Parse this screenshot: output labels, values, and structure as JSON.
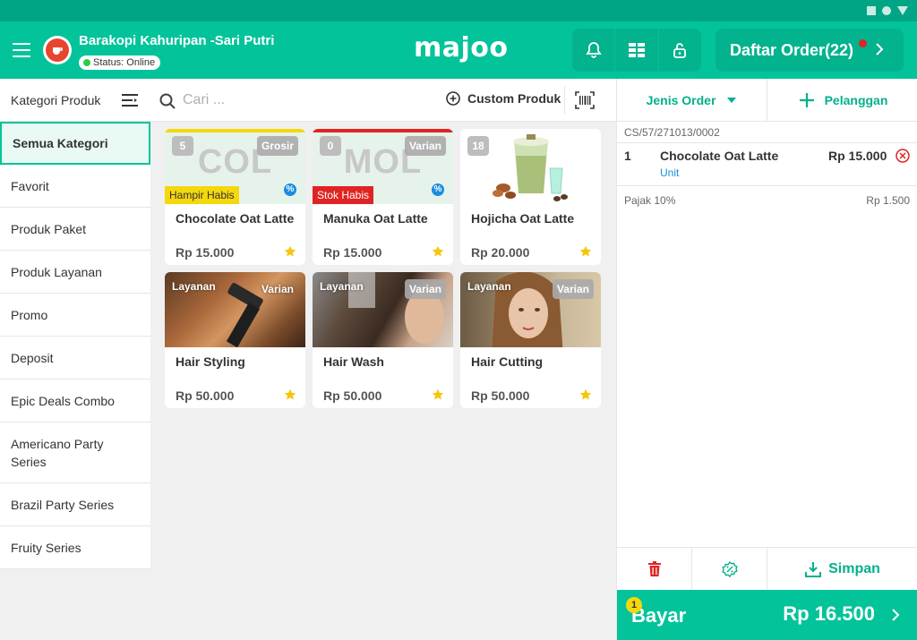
{
  "header": {
    "store_name": "Barakopi Kahuripan -Sari Putri",
    "status": "Status: Online",
    "brand": "majoo",
    "orders_label": "Daftar Order(22)"
  },
  "sidebar": {
    "title": "Kategori Produk",
    "items": [
      {
        "label": "Semua Kategori"
      },
      {
        "label": "Favorit"
      },
      {
        "label": "Produk Paket"
      },
      {
        "label": "Produk Layanan"
      },
      {
        "label": "Promo"
      },
      {
        "label": "Deposit"
      },
      {
        "label": "Epic Deals Combo"
      },
      {
        "label": "Americano Party Series"
      },
      {
        "label": "Brazil Party Series"
      },
      {
        "label": "Fruity Series"
      }
    ]
  },
  "search": {
    "placeholder": "Cari ..."
  },
  "toolbar": {
    "custom_label": "Custom Produk"
  },
  "products": [
    {
      "initials": "COL",
      "num": "5",
      "type": "Grosir",
      "stock": "Hampir Habis",
      "name": "Chocolate Oat Latte",
      "price": "Rp 15.000"
    },
    {
      "initials": "MOL",
      "num": "0",
      "type": "Varian",
      "stock": "Stok Habis",
      "name": "Manuka Oat Latte",
      "price": "Rp 15.000"
    },
    {
      "num": "18",
      "name": "Hojicha Oat Latte",
      "price": "Rp 20.000"
    },
    {
      "layanan": "Layanan",
      "type": "Varian",
      "name": "Hair Styling",
      "price": "Rp 50.000"
    },
    {
      "layanan": "Layanan",
      "type": "Varian",
      "name": "Hair Wash",
      "price": "Rp 50.000"
    },
    {
      "layanan": "Layanan",
      "type": "Varian",
      "name": "Hair Cutting",
      "price": "Rp 50.000"
    }
  ],
  "order": {
    "jenis_label": "Jenis Order",
    "pelanggan_label": "Pelanggan",
    "id": "CS/57/271013/0002",
    "items": [
      {
        "qty": "1",
        "name": "Chocolate Oat Latte",
        "unit": "Unit",
        "price": "Rp 15.000"
      }
    ],
    "tax_label": "Pajak 10%",
    "tax_value": "Rp 1.500",
    "save_label": "Simpan",
    "pay_count": "1",
    "pay_label": "Bayar",
    "total": "Rp 16.500"
  },
  "colors": {
    "brand_green": "#03c39a",
    "dark_green": "#00a585",
    "warning_yellow": "#f5d80c",
    "danger_red": "#e02424",
    "info_blue": "#1a8de0"
  }
}
